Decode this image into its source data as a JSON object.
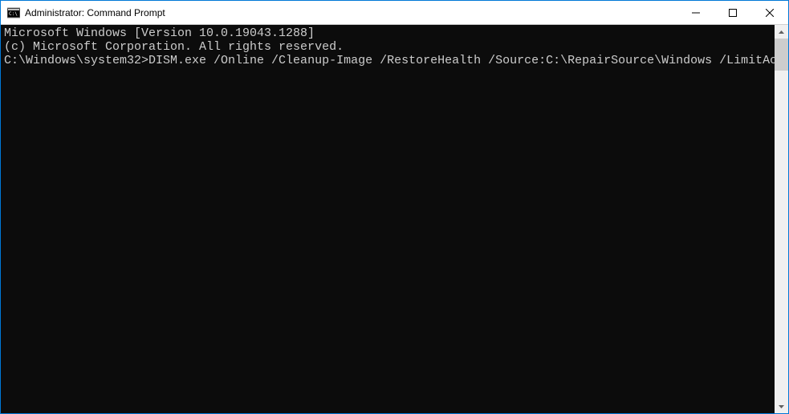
{
  "window": {
    "title": "Administrator: Command Prompt"
  },
  "terminal": {
    "line1": "Microsoft Windows [Version 10.0.19043.1288]",
    "line2": "(c) Microsoft Corporation. All rights reserved.",
    "blank": "",
    "prompt": "C:\\Windows\\system32>",
    "command": "DISM.exe /Online /Cleanup-Image /RestoreHealth /Source:C:\\RepairSource\\Windows /LimitAccess"
  }
}
